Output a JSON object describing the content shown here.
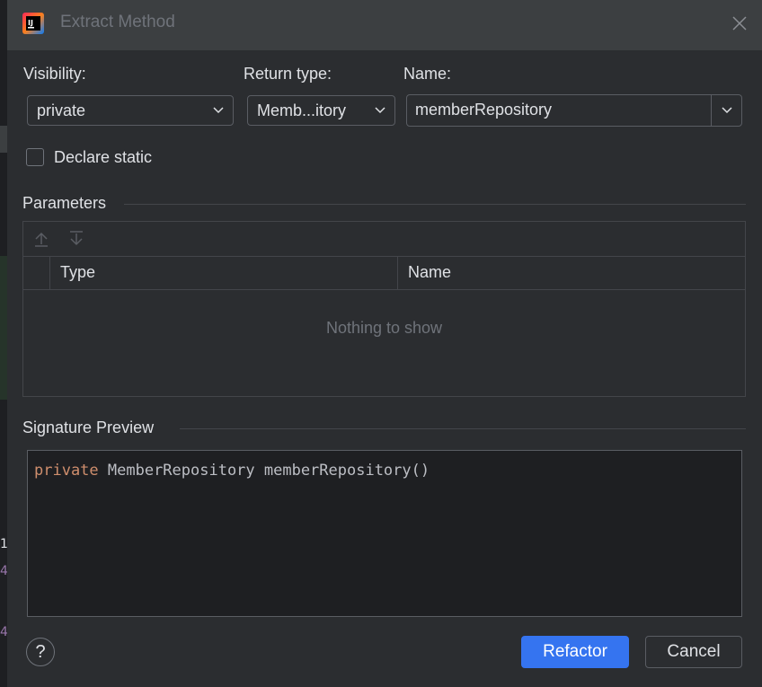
{
  "window": {
    "title": "Extract Method"
  },
  "visibility": {
    "label": "Visibility:",
    "value": "private"
  },
  "return_type": {
    "label": "Return type:",
    "value": "Memb...itory"
  },
  "name": {
    "label": "Name:",
    "value": "memberRepository"
  },
  "declare_static": {
    "label": "Declare static",
    "checked": false
  },
  "parameters": {
    "title": "Parameters",
    "columns": [
      "Type",
      "Name"
    ],
    "empty_text": "Nothing to show"
  },
  "signature": {
    "title": "Signature Preview",
    "keyword": "private",
    "rest": " MemberRepository memberRepository()"
  },
  "buttons": {
    "help": "?",
    "refactor": "Refactor",
    "cancel": "Cancel"
  },
  "colors": {
    "accent": "#3574f0",
    "keyword": "#cf8e6d",
    "background": "#2b2d30",
    "titlebar": "#3c3f41"
  },
  "background_gutter": [
    "1",
    "4",
    "4"
  ],
  "icons": [
    "intellij-logo-icon",
    "close-icon",
    "chevron-down-icon",
    "move-up-icon",
    "move-down-icon",
    "help-icon"
  ]
}
